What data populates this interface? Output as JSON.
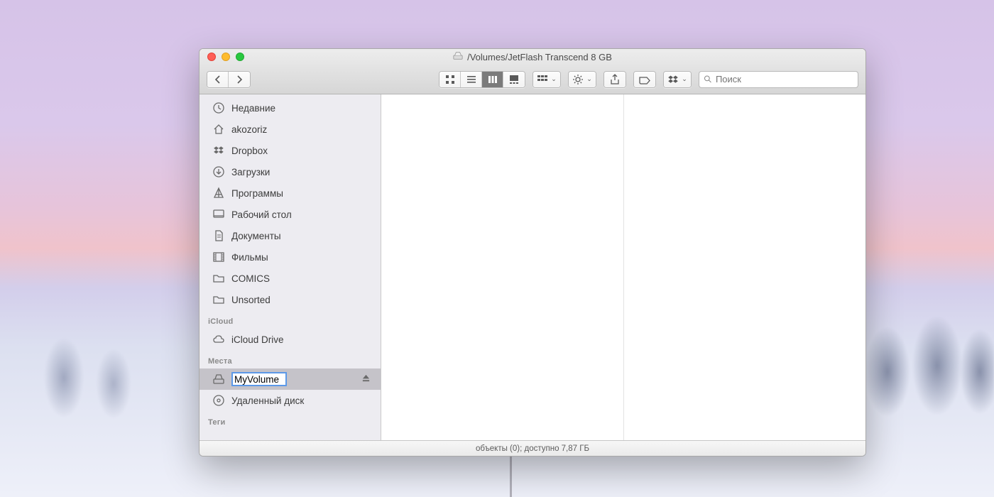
{
  "window": {
    "title": "/Volumes/JetFlash Transcend 8 GB"
  },
  "toolbar": {
    "search_placeholder": "Поиск"
  },
  "sidebar": {
    "favorites": [
      {
        "icon": "clock",
        "label": "Недавние"
      },
      {
        "icon": "home",
        "label": "akozoriz"
      },
      {
        "icon": "dropbox",
        "label": "Dropbox"
      },
      {
        "icon": "downloads",
        "label": "Загрузки"
      },
      {
        "icon": "apps",
        "label": "Программы"
      },
      {
        "icon": "desktop",
        "label": "Рабочий стол"
      },
      {
        "icon": "documents",
        "label": "Документы"
      },
      {
        "icon": "movies",
        "label": "Фильмы"
      },
      {
        "icon": "folder",
        "label": "COMICS"
      },
      {
        "icon": "folder",
        "label": "Unsorted"
      }
    ],
    "section_icloud": "iCloud",
    "icloud": [
      {
        "icon": "cloud",
        "label": "iCloud Drive"
      }
    ],
    "section_places": "Места",
    "places": [
      {
        "icon": "drive",
        "label": "MyVolume",
        "editing": true,
        "ejectable": true
      },
      {
        "icon": "disc",
        "label": "Удаленный диск"
      }
    ],
    "section_tags": "Теги"
  },
  "status": {
    "text": "объекты (0); доступно 7,87 ГБ"
  }
}
